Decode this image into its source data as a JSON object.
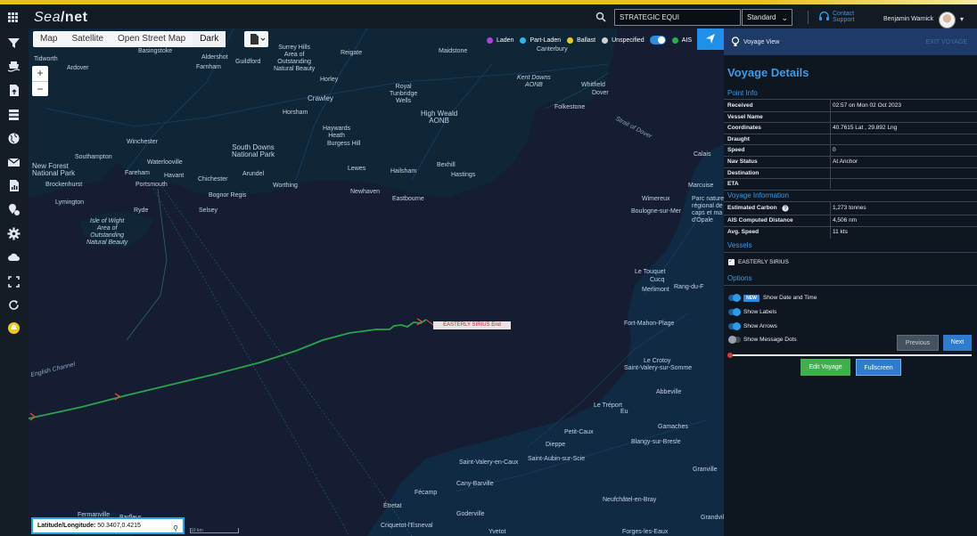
{
  "app": {
    "logo_text": "Sea",
    "logo_bold": "/net"
  },
  "header": {
    "search_value": "STRATEGIC EQUI",
    "mode_select": "Standard",
    "contact_line1": "Contact",
    "contact_line2": "Support",
    "user_name": "Benjamin Warnick"
  },
  "sidebar": {
    "icons": [
      "filter-icon",
      "vessel-icon",
      "document-upload-icon",
      "list-icon",
      "globe-icon",
      "mail-icon",
      "report-icon",
      "location-pin-icon",
      "settings-icon",
      "weather-icon",
      "fullscreen-icon",
      "refresh-icon",
      "alert-icon"
    ]
  },
  "map": {
    "layers": [
      "Map",
      "Satellite",
      "Open Street Map",
      "Dark"
    ],
    "active_layer": "Dark",
    "zoom_in": "+",
    "zoom_out": "−",
    "legend": [
      {
        "label": "Laden",
        "color": "#b33fe0"
      },
      {
        "label": "Part-Laden",
        "color": "#2bb8e8"
      },
      {
        "label": "Ballast",
        "color": "#e8c82b"
      },
      {
        "label": "Unspecified",
        "color": "#cfcfcf"
      },
      {
        "label": "AIS",
        "color": "#26b34a"
      }
    ],
    "end_label": "EASTERLY SIRIUS End",
    "coord_label": "Latitude/Longitude:",
    "coord_value": "50.3407,0.4215",
    "scale_text": "10 km",
    "places": [
      {
        "name": "Tidworth"
      },
      {
        "name": "Basingstoke"
      },
      {
        "name": "Ardover"
      },
      {
        "name": "Farnham"
      },
      {
        "name": "Aldershot"
      },
      {
        "name": "Guildford"
      },
      {
        "name": "Surrey Hills\nArea of\nOutstanding\nNatural Beauty"
      },
      {
        "name": "Reigate"
      },
      {
        "name": "Maidstone"
      },
      {
        "name": "Canterbury"
      },
      {
        "name": "Horley"
      },
      {
        "name": "Crawley"
      },
      {
        "name": "Royal\nTunbridge\nWells"
      },
      {
        "name": "Kent Downs\nAONB"
      },
      {
        "name": "Whitfield"
      },
      {
        "name": "Dover"
      },
      {
        "name": "Folkestone"
      },
      {
        "name": "High Weald\nAONB"
      },
      {
        "name": "Horsham"
      },
      {
        "name": "Haywards\nHeath"
      },
      {
        "name": "Burgess Hill"
      },
      {
        "name": "Winchester"
      },
      {
        "name": "Southampton"
      },
      {
        "name": "South Downs\nNational Park"
      },
      {
        "name": "Waterlooville"
      },
      {
        "name": "Havant"
      },
      {
        "name": "Fareham"
      },
      {
        "name": "Portsmouth"
      },
      {
        "name": "Chichester"
      },
      {
        "name": "Arundel"
      },
      {
        "name": "Worthing"
      },
      {
        "name": "Bognor Regis"
      },
      {
        "name": "Lewes"
      },
      {
        "name": "Hailsham"
      },
      {
        "name": "Bexhill"
      },
      {
        "name": "Hastings"
      },
      {
        "name": "Newhaven"
      },
      {
        "name": "Eastbourne"
      },
      {
        "name": "New Forest\nNational Park"
      },
      {
        "name": "Brockenhurst"
      },
      {
        "name": "Lymington"
      },
      {
        "name": "Ryde"
      },
      {
        "name": "Selsey"
      },
      {
        "name": "Isle of Wight\nArea of\nOutstanding\nNatural Beauty"
      },
      {
        "name": "Calais"
      },
      {
        "name": "Marcuise"
      },
      {
        "name": "Wimereux"
      },
      {
        "name": "Boulogne-sur-Mer"
      },
      {
        "name": "Parc naturel\nrégional de\ncaps et ma\nd'Opale"
      },
      {
        "name": "Le Touquet"
      },
      {
        "name": "Cucq"
      },
      {
        "name": "Merlimont"
      },
      {
        "name": "Rang-du-F"
      },
      {
        "name": "Fort-Mahon-Plage"
      },
      {
        "name": "Le Crotoy"
      },
      {
        "name": "Saint-Valery-sur-Somme"
      },
      {
        "name": "Abbeville"
      },
      {
        "name": "Le Tréport"
      },
      {
        "name": "Eu"
      },
      {
        "name": "Gamaches"
      },
      {
        "name": "Blangy-sur-Bresle"
      },
      {
        "name": "Petit-Caux"
      },
      {
        "name": "Dieppe"
      },
      {
        "name": "Saint-Valery-en-Caux"
      },
      {
        "name": "Saint-Aubin-sur-Scie"
      },
      {
        "name": "Cany-Barville"
      },
      {
        "name": "Fécamp"
      },
      {
        "name": "Étretat"
      },
      {
        "name": "Goderville"
      },
      {
        "name": "Neufchâtel-en-Bray"
      },
      {
        "name": "Fermanville"
      },
      {
        "name": "Barfleur"
      },
      {
        "name": "Criquetot-l'Esneval"
      },
      {
        "name": "Yvetot"
      },
      {
        "name": "Forges-les-Eaux"
      },
      {
        "name": "Granville"
      },
      {
        "name": "Grandvilliers"
      }
    ],
    "sea_labels": [
      "English Channel",
      "Strait of Dover"
    ]
  },
  "panel": {
    "header_label": "Voyage View",
    "exit_label": "EXIT VOYAGE",
    "title": "Voyage Details",
    "point_info_title": "Point Info",
    "point_info": [
      {
        "k": "Received",
        "v": "02:57 on Mon 02 Oct 2023"
      },
      {
        "k": "Vessel Name",
        "v": ""
      },
      {
        "k": "Coordinates",
        "v": "40.7615 Lat , 29.892 Lng"
      },
      {
        "k": "Draught",
        "v": ""
      },
      {
        "k": "Speed",
        "v": "0"
      },
      {
        "k": "Nav Status",
        "v": "At Anchor"
      },
      {
        "k": "Destination",
        "v": ""
      },
      {
        "k": "ETA",
        "v": ""
      }
    ],
    "voyage_info_title": "Voyage Information",
    "voyage_info": [
      {
        "k": "Estimated Carbon",
        "v": "1,273 tonnes"
      },
      {
        "k": "AIS Computed Distance",
        "v": "4,506 nm"
      },
      {
        "k": "Avg. Speed",
        "v": "11 kts"
      }
    ],
    "vessels_title": "Vessels",
    "vessel": "EASTERLY SIRIUS",
    "options_title": "Options",
    "new_badge": "NEW",
    "options": [
      {
        "label": "Show Date and Time",
        "on": true
      },
      {
        "label": "Show Labels",
        "on": true
      },
      {
        "label": "Show Arrows",
        "on": true
      },
      {
        "label": "Show Message Dots",
        "on": false
      }
    ],
    "prev_label": "Previous",
    "next_label": "Next",
    "edit_label": "Edit Voyage",
    "fullscreen_label": "Fullscreen"
  }
}
